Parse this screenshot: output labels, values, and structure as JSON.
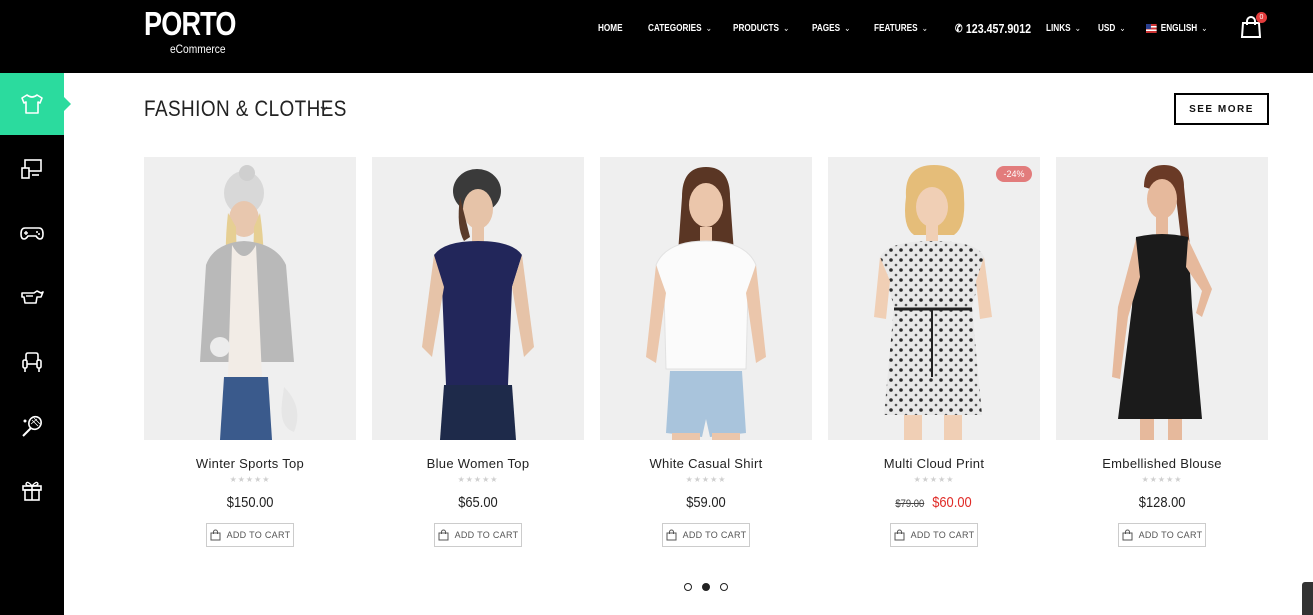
{
  "brand": {
    "name": "PORTO",
    "tagline": "eCommerce"
  },
  "nav": {
    "home": "HOME",
    "categories": "CATEGORIES",
    "products": "PRODUCTS",
    "pages": "PAGES",
    "features": "FEATURES",
    "phone": "123.457.9012",
    "links": "LINKS",
    "currency": "USD",
    "language": "ENGLISH",
    "cart_count": "0"
  },
  "sidebar": {
    "items": [
      {
        "icon": "tshirt-icon",
        "active": true
      },
      {
        "icon": "computer-icon",
        "active": false
      },
      {
        "icon": "gamepad-icon",
        "active": false
      },
      {
        "icon": "sports-car-icon",
        "active": false
      },
      {
        "icon": "armchair-icon",
        "active": false
      },
      {
        "icon": "tennis-racket-icon",
        "active": false
      },
      {
        "icon": "gift-icon",
        "active": false
      }
    ],
    "accent_color": "#2bdb9e"
  },
  "section": {
    "title": "FASHION & CLOTHES",
    "see_more": "SEE MORE"
  },
  "products": [
    {
      "name": "Winter Sports Top",
      "price": "$150.00",
      "stars": "★★★★★"
    },
    {
      "name": "Blue Women Top",
      "price": "$65.00",
      "stars": "★★★★★"
    },
    {
      "name": "White Casual Shirt",
      "price": "$59.00",
      "stars": "★★★★★"
    },
    {
      "name": "Multi Cloud Print",
      "old_price": "$79.00",
      "price": "$60.00",
      "discount": "-24%",
      "stars": "★★★★★"
    },
    {
      "name": "Embellished Blouse",
      "price": "$128.00",
      "stars": "★★★★★"
    }
  ],
  "add_to_cart_label": "ADD TO CART",
  "carousel": {
    "pages": 3,
    "active_page": 2
  }
}
